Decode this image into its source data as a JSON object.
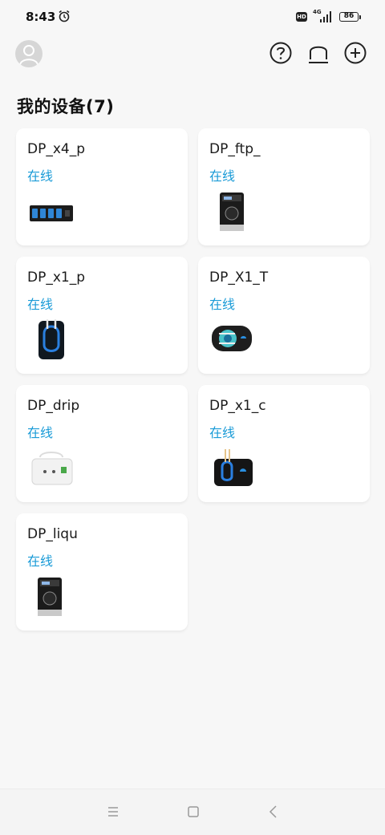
{
  "status_bar": {
    "time": "8:43",
    "hd_label": "HD",
    "network_label": "4G",
    "battery": "86"
  },
  "header": {
    "icons": [
      "avatar-icon",
      "help-icon",
      "bell-icon",
      "add-icon"
    ]
  },
  "section": {
    "title": "我的设备(7)"
  },
  "devices": [
    {
      "name": "DP_x4_p",
      "status": "在线",
      "image": "four-channel-pump"
    },
    {
      "name": "DP_ftp_",
      "status": "在线",
      "image": "peristaltic-pump-box"
    },
    {
      "name": "DP_x1_p",
      "status": "在线",
      "image": "single-pump-blue-tube"
    },
    {
      "name": "DP_X1_T",
      "status": "在线",
      "image": "oval-pump-blue"
    },
    {
      "name": "DP_drip",
      "status": "在线",
      "image": "white-drip-pump"
    },
    {
      "name": "DP_x1_c",
      "status": "在线",
      "image": "black-pump-blue-tube"
    },
    {
      "name": "DP_liqu",
      "status": "在线",
      "image": "peristaltic-pump-box"
    }
  ],
  "colors": {
    "online": "#1a9bd7",
    "background": "#f7f7f7",
    "card": "#ffffff"
  }
}
